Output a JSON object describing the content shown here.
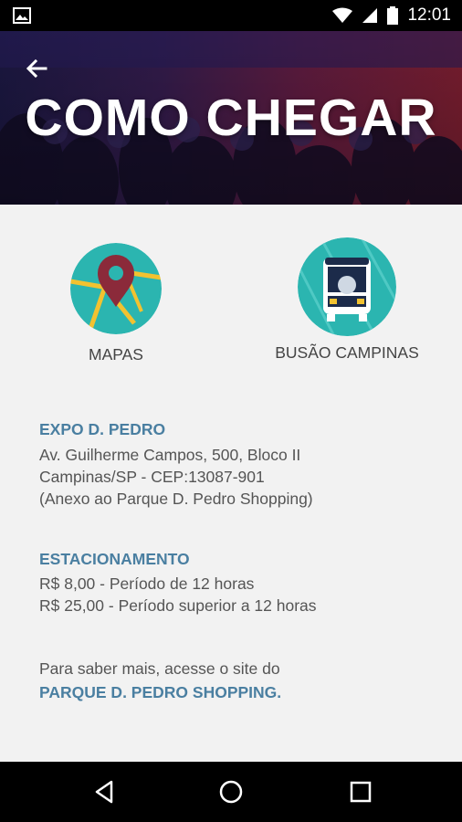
{
  "status_bar": {
    "time": "12:01",
    "icons": [
      "image-icon",
      "wifi-icon",
      "signal-icon",
      "battery-icon"
    ]
  },
  "header": {
    "title": "COMO CHEGAR",
    "back_icon": "arrow-back-icon"
  },
  "shortcuts": [
    {
      "label": "MAPAS",
      "icon": "map-pin-icon"
    },
    {
      "label": "BUSÃO CAMPINAS",
      "icon": "bus-icon"
    }
  ],
  "venue": {
    "title": "EXPO D. PEDRO",
    "lines": [
      "Av. Guilherme Campos, 500, Bloco II",
      "Campinas/SP - CEP:13087-901",
      "(Anexo ao Parque D. Pedro Shopping)"
    ]
  },
  "parking": {
    "title": "ESTACIONAMENTO",
    "lines": [
      "R$ 8,00 - Período de 12 horas",
      "R$ 25,00 - Período superior a 12 horas"
    ]
  },
  "more_info": {
    "text": "Para saber mais, acesse o site do",
    "link": "PARQUE D. PEDRO SHOPPING."
  },
  "nav": {
    "icons": [
      "back-triangle-icon",
      "home-circle-icon",
      "recents-square-icon"
    ]
  },
  "colors": {
    "accent": "#4a7fa1",
    "teal": "#2bb5b0",
    "pin": "#8b2a3a",
    "road": "#f2c230"
  }
}
